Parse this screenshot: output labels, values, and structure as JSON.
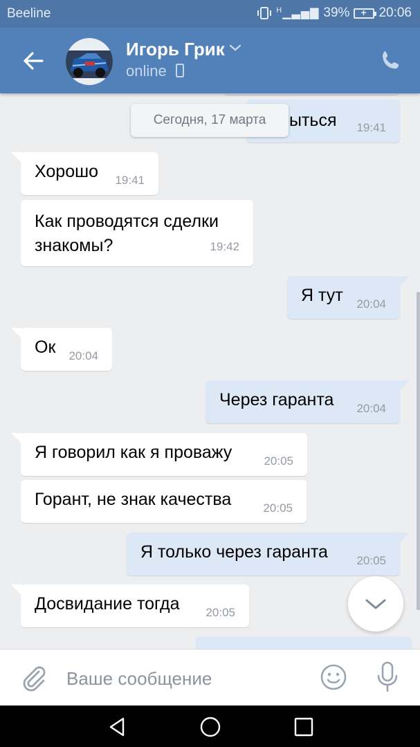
{
  "status_bar": {
    "carrier": "Beeline",
    "signal": "H",
    "battery": "39%",
    "time": "20:06"
  },
  "header": {
    "contact_name": "Игорь Грик",
    "status": "online"
  },
  "chat": {
    "date_chip": "Сегодня, 17 марта",
    "partial_out": {
      "text": "ыться",
      "time": "19:41"
    },
    "messages": [
      {
        "dir": "in",
        "text": "Хорошо",
        "time": "19:41"
      },
      {
        "dir": "in",
        "text_lines": [
          "Как проводятся сделки",
          "знакомы?"
        ],
        "time": "19:42"
      },
      {
        "dir": "out",
        "text": "Я тут",
        "time": "20:04"
      },
      {
        "dir": "in",
        "text": "Ок",
        "time": "20:04"
      },
      {
        "dir": "out",
        "text": "Через гаранта",
        "time": "20:04"
      },
      {
        "dir": "in",
        "text": "Я говорил как я проважу",
        "time": "20:05"
      },
      {
        "dir": "in",
        "text": "Горант, не знак качества",
        "time": "20:05"
      },
      {
        "dir": "out",
        "text": "Я только через гаранта",
        "time": "20:05"
      },
      {
        "dir": "in",
        "text": "Досвидание тогда",
        "time": "20:05"
      }
    ]
  },
  "composer": {
    "placeholder": "Ваше сообщение"
  },
  "colors": {
    "header_bg": "#5181b8",
    "status_bar_bg": "#4e77a8",
    "chat_bg": "#edeef0",
    "outgoing_bubble": "#dce8f6",
    "incoming_bubble": "#ffffff"
  },
  "icons": {
    "back": "arrow-left-icon",
    "chevron": "chevron-down-icon",
    "device": "phone-device-icon",
    "call": "phone-icon",
    "scroll": "chevron-down-icon",
    "attach": "paperclip-icon",
    "emoji": "smiley-icon",
    "mic": "microphone-icon",
    "nav_back": "triangle-back-icon",
    "nav_home": "circle-home-icon",
    "nav_recent": "square-recent-icon"
  }
}
